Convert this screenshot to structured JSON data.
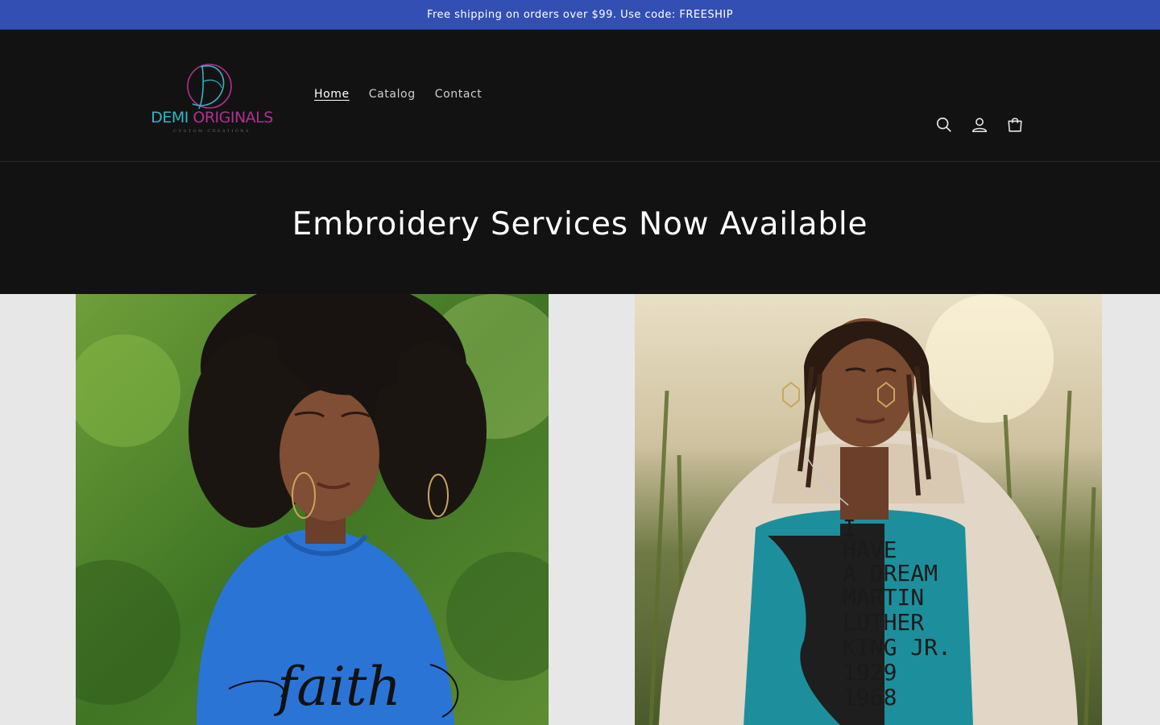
{
  "announcement": {
    "text": "Free shipping on orders over $99. Use code: FREESHIP"
  },
  "logo": {
    "name_part1": "DEMI ",
    "name_part2": "ORIGINALS",
    "tagline": "CUSTOM CREATIONS"
  },
  "nav": {
    "items": [
      {
        "label": "Home"
      },
      {
        "label": "Catalog"
      },
      {
        "label": "Contact"
      }
    ]
  },
  "header_icons": [
    "search-icon",
    "account-icon",
    "cart-icon"
  ],
  "banner": {
    "title": "Embroidery Services Now Available"
  },
  "gallery": {
    "left": {
      "shirt_text": "faith"
    },
    "right": {
      "shirt_text": [
        "I",
        "HAVE",
        "A DREAM",
        "MARTIN",
        "LUTHER",
        "KING JR.",
        "1929",
        "1968"
      ]
    }
  },
  "colors": {
    "announcement_bg": "#334fb4",
    "header_bg": "#121212",
    "logo_teal": "#2fb6c9",
    "logo_magenta": "#b22f92"
  }
}
